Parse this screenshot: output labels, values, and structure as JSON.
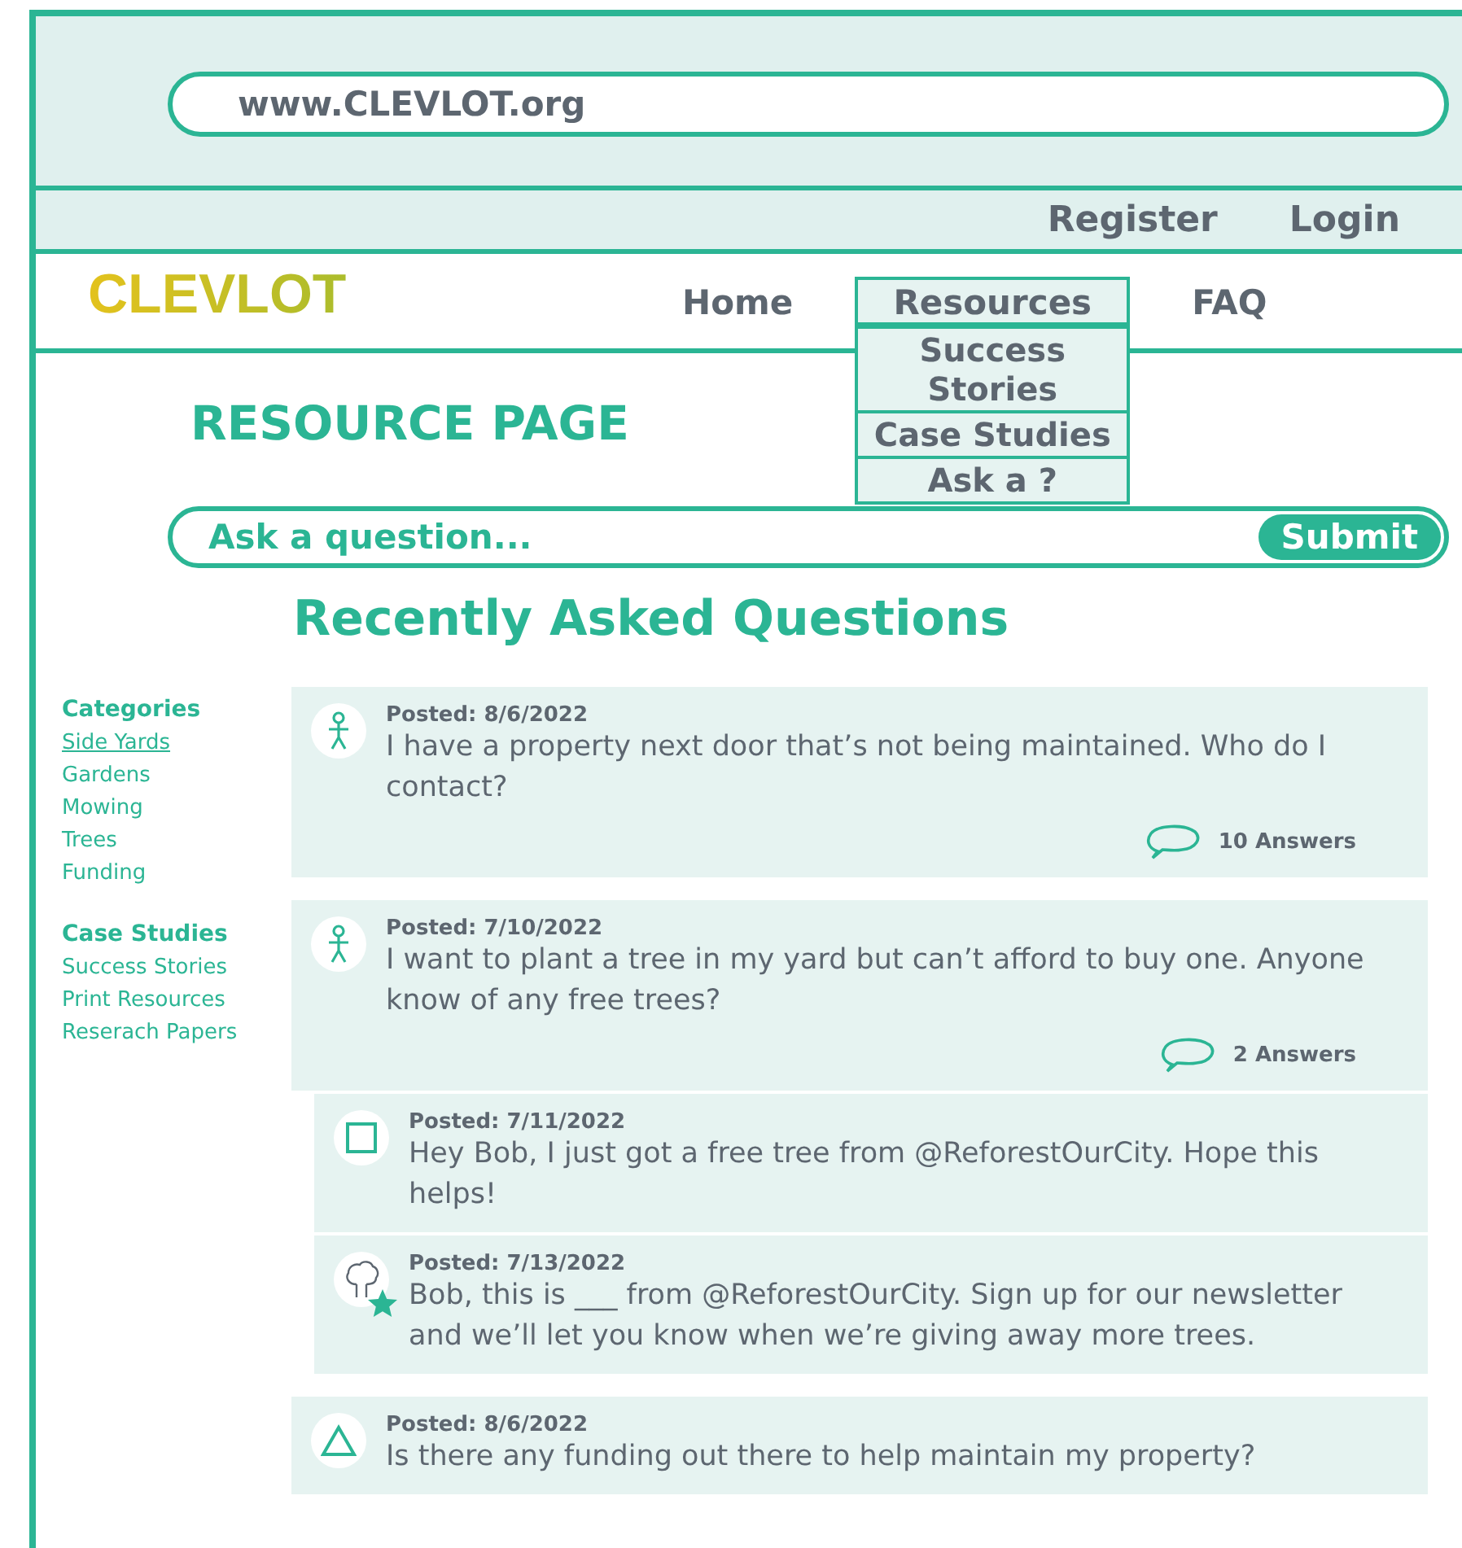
{
  "address_bar": {
    "url": "www.CLEVLOT.org"
  },
  "account_links": [
    "Register",
    "Login"
  ],
  "logo": "CLEVLOT",
  "nav": [
    {
      "label": "Home",
      "selected": false
    },
    {
      "label": "Resources",
      "selected": true,
      "menu": [
        "Success Stories",
        "Case Studies",
        "Ask a ?"
      ]
    },
    {
      "label": "FAQ",
      "selected": false
    }
  ],
  "page_title": "RESOURCE PAGE",
  "ask": {
    "placeholder": "Ask a question...",
    "button": "Submit"
  },
  "section_title": "Recently Asked Questions",
  "sidebar": [
    {
      "title": "Categories",
      "items": [
        {
          "label": "Side Yards",
          "selected": true
        },
        {
          "label": "Gardens",
          "selected": false
        },
        {
          "label": "Mowing",
          "selected": false
        },
        {
          "label": "Trees",
          "selected": false
        },
        {
          "label": "Funding",
          "selected": false
        }
      ]
    },
    {
      "title": "Case Studies",
      "items": [
        {
          "label": "Success Stories",
          "selected": false
        },
        {
          "label": "Print Resources",
          "selected": false
        },
        {
          "label": "Reserach Papers",
          "selected": false
        }
      ]
    }
  ],
  "posts": [
    {
      "kind": "person",
      "posted": "Posted: 8/6/2022",
      "text": "I have a property next door that’s not being maintained. Who do I contact?",
      "answers": "10 Answers"
    },
    {
      "kind": "person",
      "posted": "Posted: 7/10/2022",
      "text": "I want to plant a tree in my yard but can’t afford to buy one. Anyone know of any free trees?",
      "answers": "2 Answers",
      "children": [
        {
          "kind": "square",
          "posted": "Posted: 7/11/2022",
          "text": "Hey Bob, I just got a free tree from @ReforestOurCity. Hope this helps!"
        },
        {
          "kind": "tree",
          "posted": "Posted: 7/13/2022",
          "text": "Bob, this is ___ from @ReforestOurCity. Sign up for our newsletter and we’ll let you know when we’re giving away more trees."
        }
      ]
    },
    {
      "kind": "triangle",
      "posted": "Posted: 8/6/2022",
      "text": "Is there any funding out there to help maintain my property?"
    }
  ]
}
